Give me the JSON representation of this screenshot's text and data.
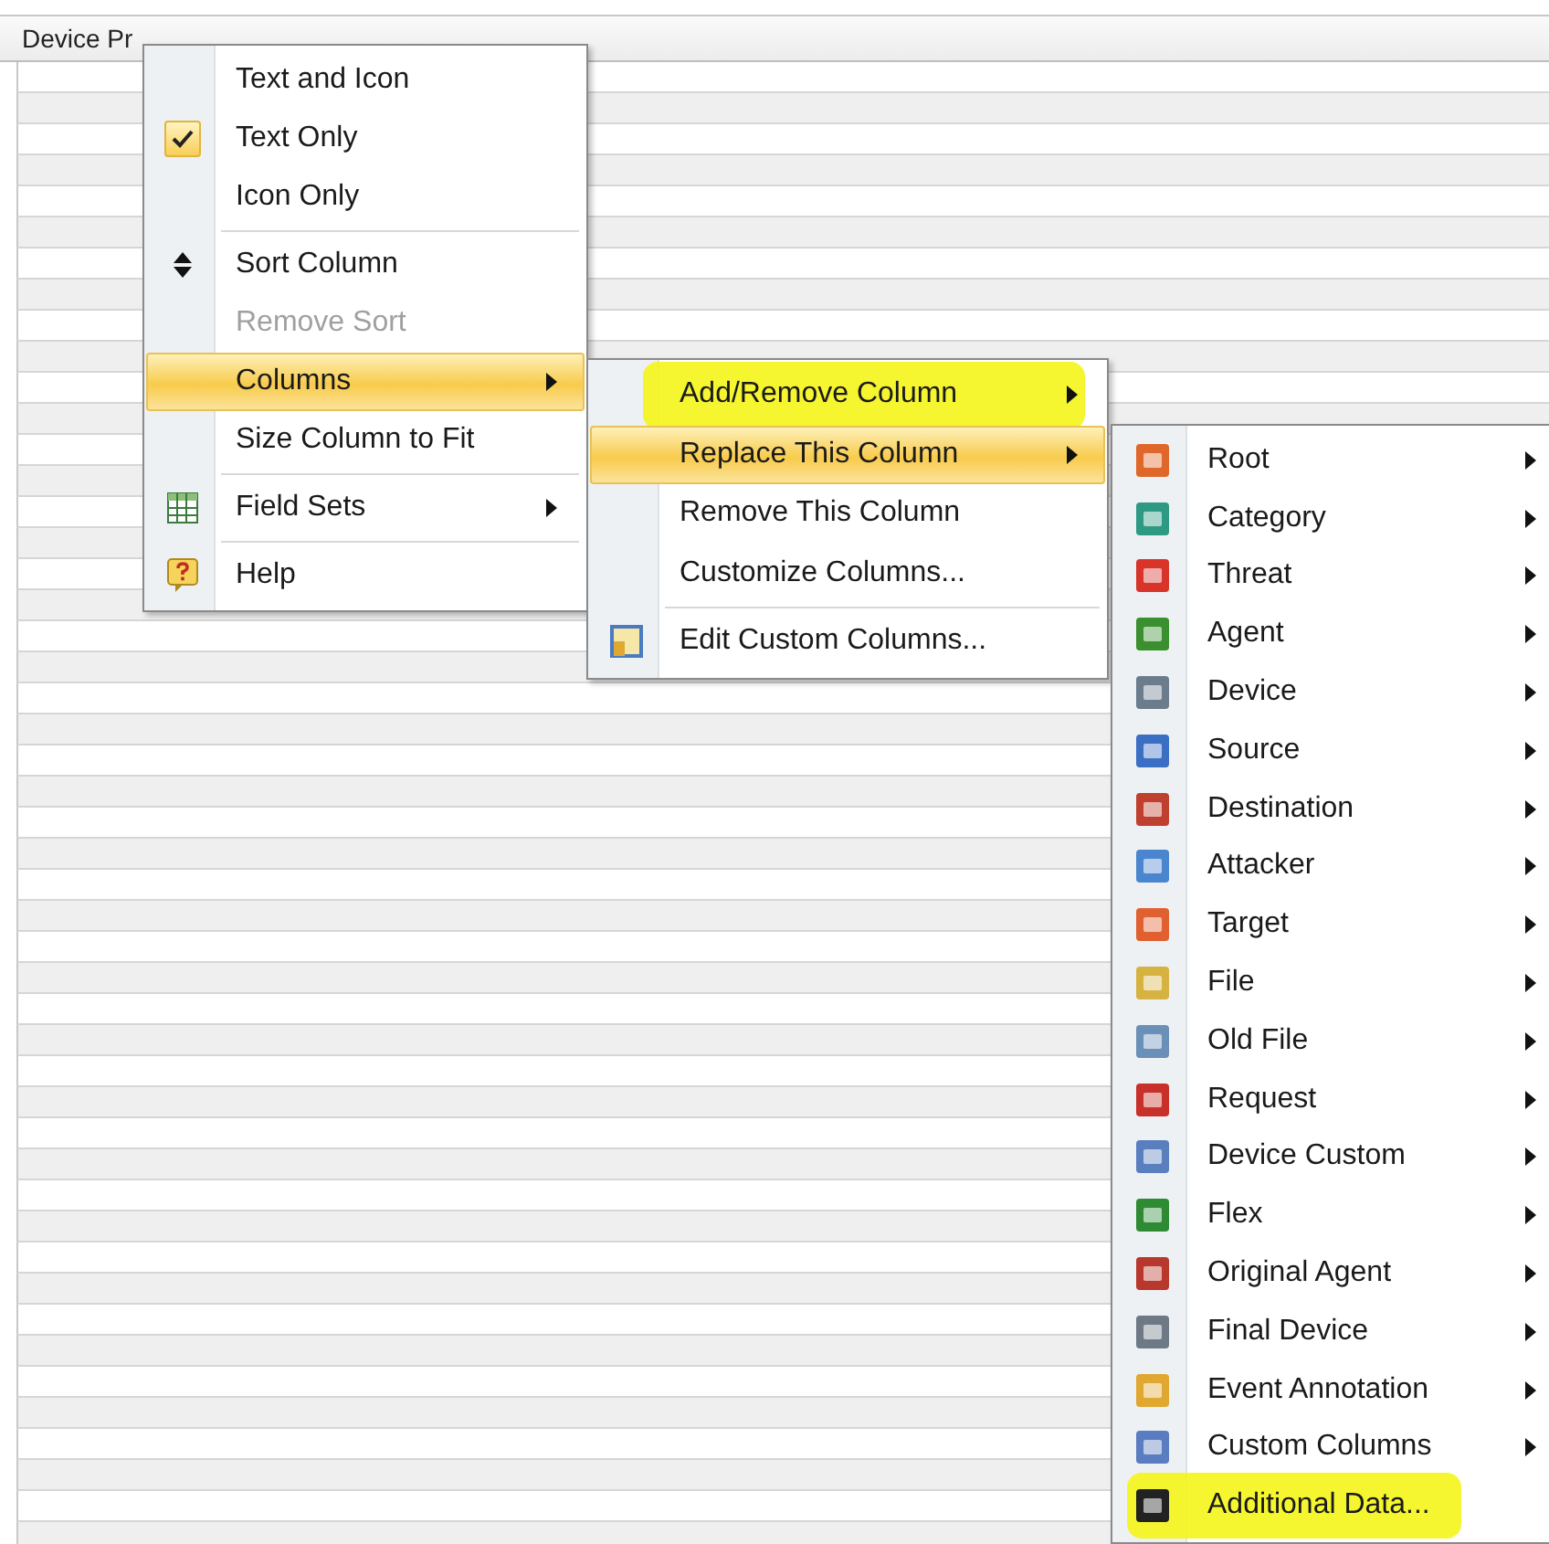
{
  "table": {
    "header": "Device Pr"
  },
  "menus": [
    {
      "items": [
        {
          "label": "Text and Icon",
          "kind": "plain",
          "checked": false,
          "disabled": false,
          "selected": false,
          "submenu": false,
          "marked": false,
          "separator_before": false
        },
        {
          "label": "Text Only",
          "kind": "plain",
          "checked": true,
          "disabled": false,
          "selected": false,
          "submenu": false,
          "marked": false,
          "separator_before": false
        },
        {
          "label": "Icon Only",
          "kind": "plain",
          "checked": false,
          "disabled": false,
          "selected": false,
          "submenu": false,
          "marked": false,
          "separator_before": false
        },
        {
          "label": "Sort Column",
          "kind": "sort",
          "checked": false,
          "disabled": false,
          "selected": false,
          "submenu": false,
          "marked": false,
          "separator_before": true
        },
        {
          "label": "Remove Sort",
          "kind": "plain",
          "checked": false,
          "disabled": true,
          "selected": false,
          "submenu": false,
          "marked": false,
          "separator_before": false
        },
        {
          "label": "Columns",
          "kind": "plain",
          "checked": false,
          "disabled": false,
          "selected": true,
          "submenu": true,
          "marked": false,
          "separator_before": false
        },
        {
          "label": "Size Column to Fit",
          "kind": "plain",
          "checked": false,
          "disabled": false,
          "selected": false,
          "submenu": false,
          "marked": false,
          "separator_before": false
        },
        {
          "label": "Field Sets",
          "kind": "grid",
          "checked": false,
          "disabled": false,
          "selected": false,
          "submenu": true,
          "marked": false,
          "separator_before": true
        },
        {
          "label": "Help",
          "kind": "help",
          "checked": false,
          "disabled": false,
          "selected": false,
          "submenu": false,
          "marked": false,
          "separator_before": true
        }
      ]
    },
    {
      "items": [
        {
          "label": "Add/Remove Column",
          "kind": "plain",
          "checked": false,
          "disabled": false,
          "selected": false,
          "submenu": true,
          "marked": true,
          "separator_before": false
        },
        {
          "label": "Replace This Column",
          "kind": "plain",
          "checked": false,
          "disabled": false,
          "selected": true,
          "submenu": true,
          "marked": false,
          "separator_before": false
        },
        {
          "label": "Remove This Column",
          "kind": "plain",
          "checked": false,
          "disabled": false,
          "selected": false,
          "submenu": false,
          "marked": false,
          "separator_before": false
        },
        {
          "label": "Customize Columns...",
          "kind": "plain",
          "checked": false,
          "disabled": false,
          "selected": false,
          "submenu": false,
          "marked": false,
          "separator_before": false
        },
        {
          "label": "Edit Custom Columns...",
          "kind": "custom",
          "checked": false,
          "disabled": false,
          "selected": false,
          "submenu": false,
          "marked": false,
          "separator_before": true
        }
      ]
    },
    {
      "items": [
        {
          "label": "Root",
          "kind": "field",
          "checked": false,
          "disabled": false,
          "selected": false,
          "submenu": true,
          "marked": false,
          "separator_before": false
        },
        {
          "label": "Category",
          "kind": "field",
          "checked": false,
          "disabled": false,
          "selected": false,
          "submenu": true,
          "marked": false,
          "separator_before": false
        },
        {
          "label": "Threat",
          "kind": "field",
          "checked": false,
          "disabled": false,
          "selected": false,
          "submenu": true,
          "marked": false,
          "separator_before": false
        },
        {
          "label": "Agent",
          "kind": "field",
          "checked": false,
          "disabled": false,
          "selected": false,
          "submenu": true,
          "marked": false,
          "separator_before": false
        },
        {
          "label": "Device",
          "kind": "field",
          "checked": false,
          "disabled": false,
          "selected": false,
          "submenu": true,
          "marked": false,
          "separator_before": false
        },
        {
          "label": "Source",
          "kind": "field",
          "checked": false,
          "disabled": false,
          "selected": false,
          "submenu": true,
          "marked": false,
          "separator_before": false
        },
        {
          "label": "Destination",
          "kind": "field",
          "checked": false,
          "disabled": false,
          "selected": false,
          "submenu": true,
          "marked": false,
          "separator_before": false
        },
        {
          "label": "Attacker",
          "kind": "field",
          "checked": false,
          "disabled": false,
          "selected": false,
          "submenu": true,
          "marked": false,
          "separator_before": false
        },
        {
          "label": "Target",
          "kind": "field",
          "checked": false,
          "disabled": false,
          "selected": false,
          "submenu": true,
          "marked": false,
          "separator_before": false
        },
        {
          "label": "File",
          "kind": "field",
          "checked": false,
          "disabled": false,
          "selected": false,
          "submenu": true,
          "marked": false,
          "separator_before": false
        },
        {
          "label": "Old File",
          "kind": "field",
          "checked": false,
          "disabled": false,
          "selected": false,
          "submenu": true,
          "marked": false,
          "separator_before": false
        },
        {
          "label": "Request",
          "kind": "field",
          "checked": false,
          "disabled": false,
          "selected": false,
          "submenu": true,
          "marked": false,
          "separator_before": false
        },
        {
          "label": "Device Custom",
          "kind": "field",
          "checked": false,
          "disabled": false,
          "selected": false,
          "submenu": true,
          "marked": false,
          "separator_before": false
        },
        {
          "label": "Flex",
          "kind": "field",
          "checked": false,
          "disabled": false,
          "selected": false,
          "submenu": true,
          "marked": false,
          "separator_before": false
        },
        {
          "label": "Original Agent",
          "kind": "field",
          "checked": false,
          "disabled": false,
          "selected": false,
          "submenu": true,
          "marked": false,
          "separator_before": false
        },
        {
          "label": "Final Device",
          "kind": "field",
          "checked": false,
          "disabled": false,
          "selected": false,
          "submenu": true,
          "marked": false,
          "separator_before": false
        },
        {
          "label": "Event Annotation",
          "kind": "field",
          "checked": false,
          "disabled": false,
          "selected": false,
          "submenu": true,
          "marked": false,
          "separator_before": false
        },
        {
          "label": "Custom Columns",
          "kind": "field",
          "checked": false,
          "disabled": false,
          "selected": false,
          "submenu": true,
          "marked": false,
          "separator_before": false
        },
        {
          "label": "Additional Data...",
          "kind": "field",
          "checked": false,
          "disabled": false,
          "selected": false,
          "submenu": false,
          "marked": true,
          "separator_before": false
        }
      ]
    }
  ]
}
